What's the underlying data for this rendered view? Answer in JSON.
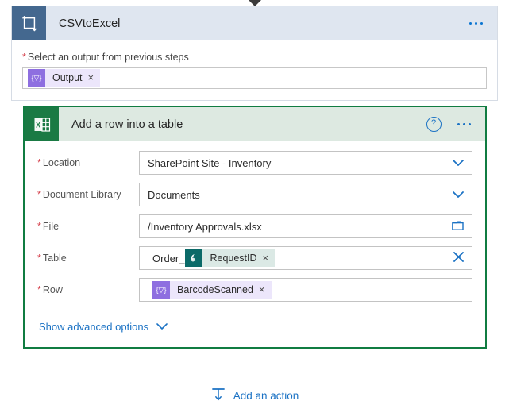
{
  "colors": {
    "trigger_header_bg": "#dfe6f0",
    "trigger_icon_bg": "#44688f",
    "excel_green": "#107c41",
    "excel_header_bg": "#dde9e1",
    "link_blue": "#1b72c4",
    "required_red": "#d64550",
    "token_purple": "#8e6fe0",
    "token_teal": "#0b6a68"
  },
  "trigger_card": {
    "icon": "convert-transform-icon",
    "title": "CSVtoExcel",
    "overflow_icon": "ellipsis-icon",
    "field": {
      "label": "Select an output from previous steps",
      "required_marker": "*",
      "token": {
        "icon": "expression-token-icon",
        "glyph": "{▽}",
        "label": "Output",
        "remove_icon": "×"
      }
    }
  },
  "excel_card": {
    "icon": "excel-icon",
    "title": "Add a row into a table",
    "help_icon": "question-mark-icon",
    "help_glyph": "?",
    "overflow_icon": "ellipsis-icon",
    "required_marker": "*",
    "fields": [
      {
        "label": "Location",
        "required": true,
        "value": "SharePoint Site - Inventory",
        "control": "dropdown",
        "trailing_icon": "chevron-down-icon",
        "trailing_glyph": "⌄"
      },
      {
        "label": "Document Library",
        "required": true,
        "value": "Documents",
        "control": "dropdown",
        "trailing_icon": "chevron-down-icon",
        "trailing_glyph": "⌄"
      },
      {
        "label": "File",
        "required": true,
        "value": "/Inventory Approvals.xlsx",
        "control": "file-picker",
        "trailing_icon": "folder-icon",
        "trailing_glyph": ""
      },
      {
        "label": "Table",
        "required": true,
        "control": "token-field",
        "prefix_text": "Order_",
        "token": {
          "icon": "sharepoint-token-icon",
          "label": "RequestID",
          "remove_icon": "×"
        },
        "trailing_icon": "clear-x-icon",
        "trailing_glyph": "✕"
      },
      {
        "label": "Row",
        "required": true,
        "control": "token-field",
        "token": {
          "icon": "expression-token-icon",
          "glyph": "{▽}",
          "label": "BarcodeScanned",
          "remove_icon": "×"
        }
      }
    ],
    "advanced": {
      "label": "Show advanced options",
      "icon": "chevron-down-icon",
      "glyph": "⌄"
    }
  },
  "add_action": {
    "label": "Add an action",
    "icon": "insert-action-icon"
  }
}
